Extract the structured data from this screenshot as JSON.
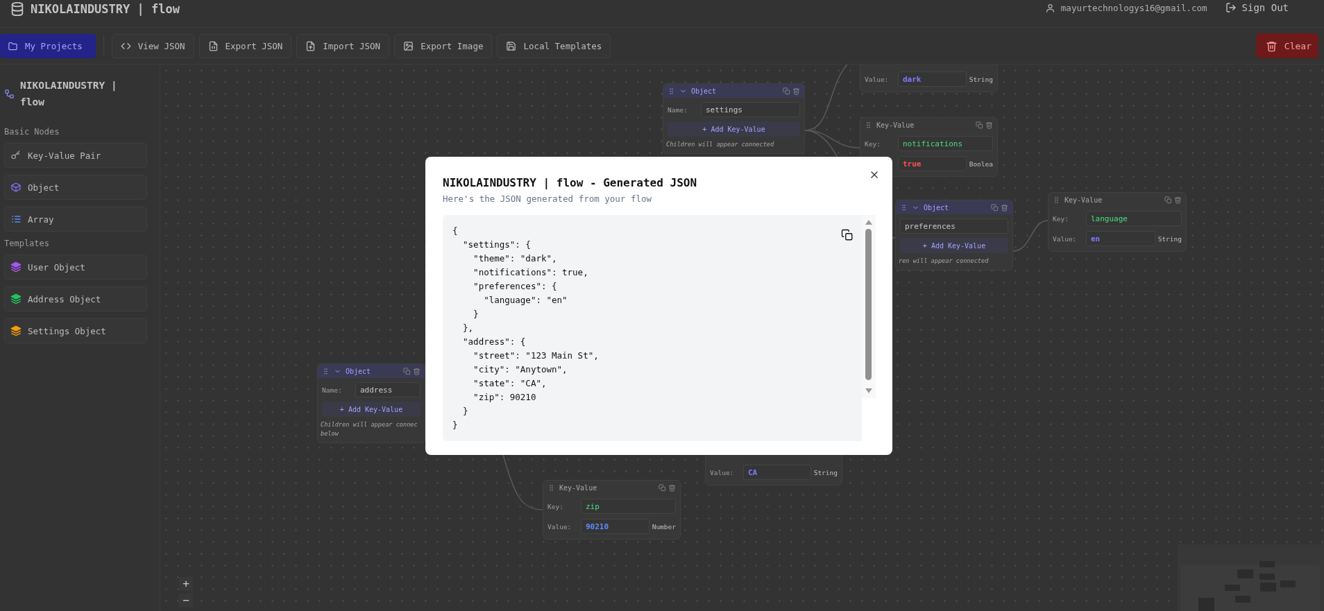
{
  "header": {
    "title": "NIKOLAINDUSTRY | flow",
    "user_email": "mayurtechnologys16@gmail.com",
    "sign_out": "Sign Out"
  },
  "toolbar": {
    "buttons": [
      {
        "label": "My Projects",
        "kind": "primary"
      },
      {
        "label": "View JSON",
        "kind": "plain"
      },
      {
        "label": "Export JSON",
        "kind": "plain"
      },
      {
        "label": "Import JSON",
        "kind": "plain"
      },
      {
        "label": "Export Image",
        "kind": "plain"
      },
      {
        "label": "Local Templates",
        "kind": "plain"
      }
    ],
    "clear_button": {
      "label": "Clear"
    }
  },
  "sidebar": {
    "title": "NIKOLAINDUSTRY | flow",
    "sections": [
      {
        "heading": "Basic Nodes",
        "items": [
          {
            "label": "Key-Value Pair",
            "kind": "key_value"
          },
          {
            "label": "Object",
            "kind": "object"
          },
          {
            "label": "Array",
            "kind": "array"
          }
        ]
      },
      {
        "heading": "Templates",
        "items": [
          {
            "label": "User Object",
            "kind": "template",
            "color": "#a855f7"
          },
          {
            "label": "Address Object",
            "kind": "template",
            "color": "#22c55e"
          },
          {
            "label": "Settings Object",
            "kind": "template",
            "color": "#f59e0b"
          }
        ]
      }
    ]
  },
  "canvas": {
    "nodes": [
      {
        "kind": "key_value",
        "value_label": "Value:",
        "value": "dark",
        "color": "#7c7cff",
        "type": "String"
      },
      {
        "kind": "object",
        "header": "Object",
        "name_label": "Name:",
        "name": "settings",
        "add_label": "+ Add Key-Value",
        "hint": "Children will appear connected"
      },
      {
        "kind": "key_value",
        "header": "Key-Value",
        "key_label": "Key:",
        "key": "notifications",
        "value": "true",
        "color": "#ff5050",
        "type": "Boolea"
      },
      {
        "kind": "object",
        "header": "Object",
        "name": "preferences",
        "add_label": "+ Add Key-Value",
        "hint": "ren will appear connected"
      },
      {
        "kind": "key_value",
        "header": "Key-Value",
        "key_label": "Key:",
        "key": "language",
        "value_label": "Value:",
        "value": "en",
        "color": "#7c7cff",
        "type": "String"
      },
      {
        "kind": "object",
        "header": "Object",
        "name_label": "Name:",
        "name": "address",
        "add_label": "+ Add Key-Value",
        "hint": "Children will appear connec\nbelow"
      },
      {
        "kind": "key_value",
        "value_label": "Value:",
        "value": "CA",
        "color": "#7c7cff",
        "type": "String"
      },
      {
        "kind": "key_value",
        "header": "Key-Value",
        "key_label": "Key:",
        "key": "zip",
        "value_label": "Value:",
        "value": "90210",
        "color": "#5a8cff",
        "type": "Number"
      }
    ],
    "zoom_controls": [
      "+",
      "−"
    ]
  },
  "modal": {
    "title": "NIKOLAINDUSTRY | flow - Generated JSON",
    "subtitle": "Here's the JSON generated from your flow",
    "code_lines": [
      "{",
      "  \"settings\": {",
      "    \"theme\": \"dark\",",
      "    \"notifications\": true,",
      "    \"preferences\": {",
      "      \"language\": \"en\"",
      "    }",
      "  },",
      "  \"address\": {",
      "    \"street\": \"123 Main St\",",
      "    \"city\": \"Anytown\",",
      "    \"state\": \"CA\",",
      "    \"zip\": 90210",
      "  }",
      "}"
    ]
  }
}
